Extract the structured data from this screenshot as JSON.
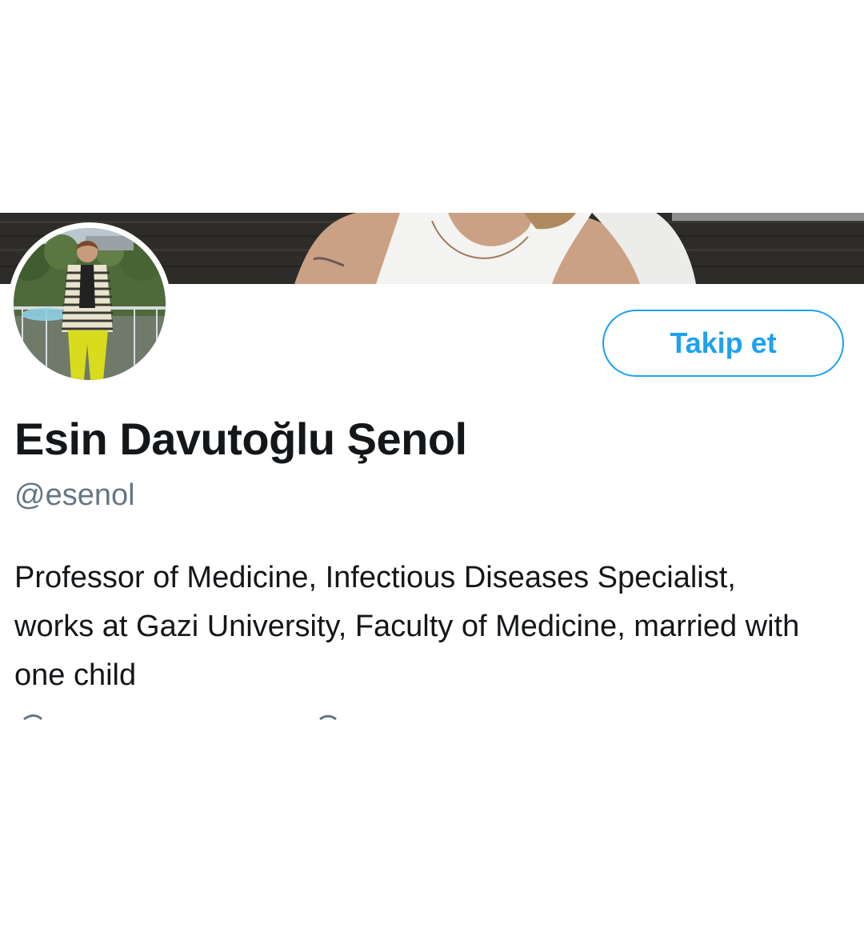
{
  "profile": {
    "display_name": "Esin Davutoğlu Şenol",
    "handle": "@esenol",
    "bio": "Professor of Medicine, Infectious Diseases Specialist, works at Gazi University, Faculty of Medicine, married with one child"
  },
  "actions": {
    "follow_label": "Takip et"
  },
  "colors": {
    "accent": "#1da1f2",
    "name_text": "#14171a",
    "handle_text": "#657786"
  }
}
